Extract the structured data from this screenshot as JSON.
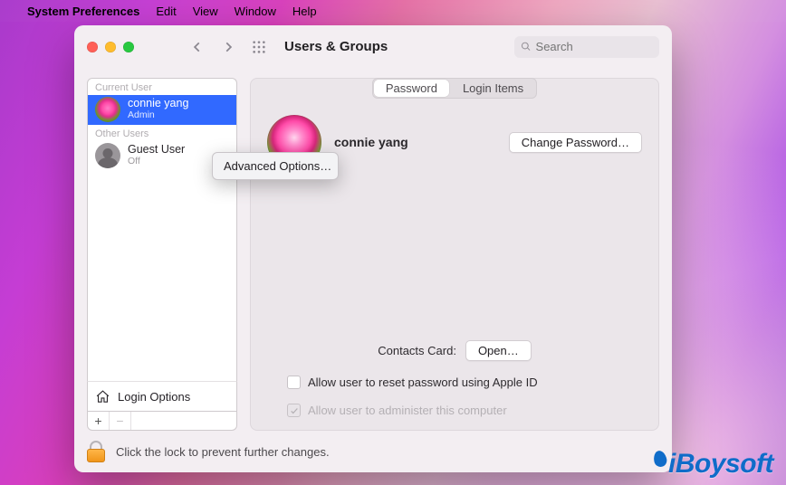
{
  "menubar": {
    "app": "System Preferences",
    "items": [
      "Edit",
      "View",
      "Window",
      "Help"
    ]
  },
  "window": {
    "title": "Users & Groups",
    "search_placeholder": "Search"
  },
  "sidebar": {
    "current_label": "Current User",
    "other_label": "Other Users",
    "current": {
      "name": "connie yang",
      "role": "Admin"
    },
    "others": [
      {
        "name": "Guest User",
        "role": "Off"
      }
    ],
    "login_options": "Login Options"
  },
  "tabs": {
    "password": "Password",
    "login_items": "Login Items"
  },
  "profile": {
    "name": "connie yang",
    "change_pw": "Change Password…"
  },
  "contacts": {
    "label": "Contacts Card:",
    "open": "Open…"
  },
  "checks": {
    "allow_reset": "Allow user to reset password using Apple ID",
    "allow_admin": "Allow user to administer this computer"
  },
  "footer": {
    "lock_text": "Click the lock to prevent further changes."
  },
  "context_menu": {
    "advanced": "Advanced Options…"
  },
  "watermark": "iBoysoft"
}
